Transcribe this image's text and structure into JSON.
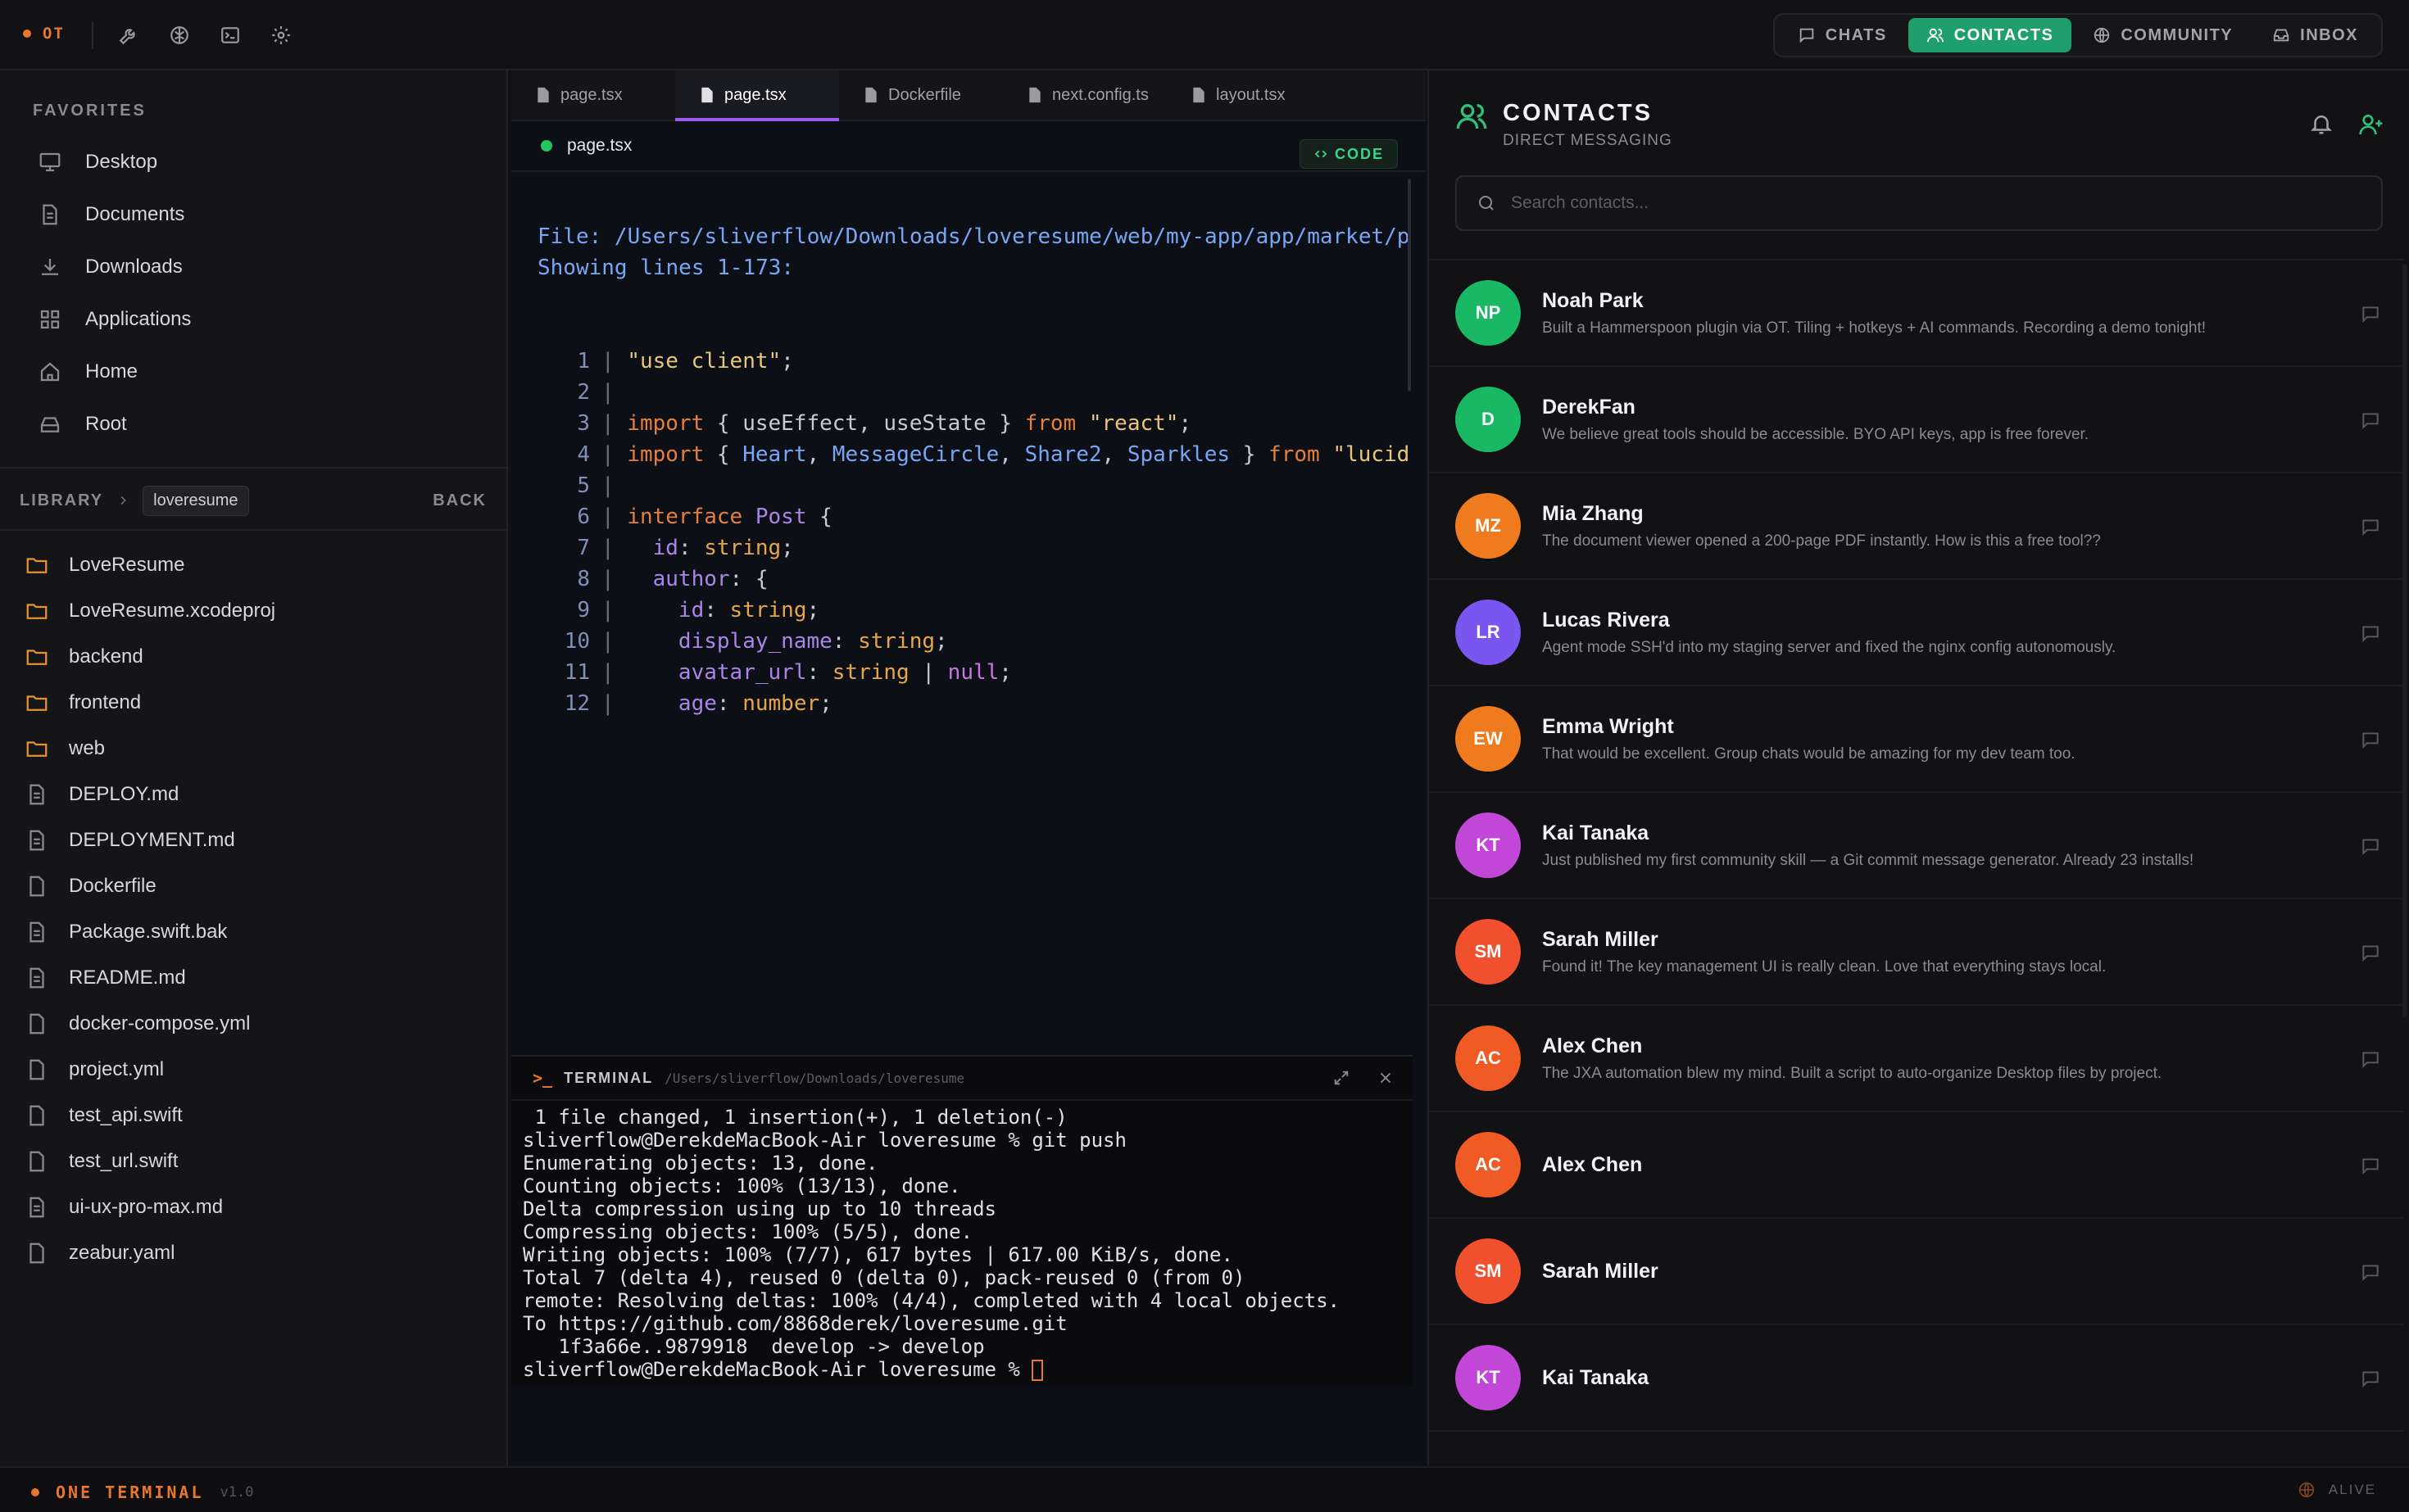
{
  "app": {
    "short_name": "OT",
    "name": "ONE TERMINAL",
    "version": "v1.0",
    "status": "ALIVE"
  },
  "topbar": {
    "icons": [
      "wrench-icon",
      "brain-icon",
      "terminal-icon",
      "gear-icon"
    ]
  },
  "nav": {
    "tabs": [
      {
        "label": "CHATS",
        "icon": "chat-icon",
        "active": false
      },
      {
        "label": "CONTACTS",
        "icon": "users-icon",
        "active": true
      },
      {
        "label": "COMMUNITY",
        "icon": "globe-icon",
        "active": false
      },
      {
        "label": "INBOX",
        "icon": "inbox-icon",
        "active": false
      }
    ]
  },
  "sidebar": {
    "favorites_title": "FAVORITES",
    "favorites": [
      {
        "label": "Desktop",
        "icon": "monitor-icon"
      },
      {
        "label": "Documents",
        "icon": "document-icon"
      },
      {
        "label": "Downloads",
        "icon": "download-icon"
      },
      {
        "label": "Applications",
        "icon": "grid-icon"
      },
      {
        "label": "Home",
        "icon": "home-icon"
      },
      {
        "label": "Root",
        "icon": "drive-icon"
      }
    ],
    "library_title": "LIBRARY",
    "breadcrumb": "loveresume",
    "back_label": "BACK",
    "files": [
      {
        "name": "LoveResume",
        "type": "folder"
      },
      {
        "name": "LoveResume.xcodeproj",
        "type": "folder"
      },
      {
        "name": "backend",
        "type": "folder"
      },
      {
        "name": "frontend",
        "type": "folder"
      },
      {
        "name": "web",
        "type": "folder"
      },
      {
        "name": "DEPLOY.md",
        "type": "doc"
      },
      {
        "name": "DEPLOYMENT.md",
        "type": "doc"
      },
      {
        "name": "Dockerfile",
        "type": "file"
      },
      {
        "name": "Package.swift.bak",
        "type": "doc"
      },
      {
        "name": "README.md",
        "type": "doc"
      },
      {
        "name": "docker-compose.yml",
        "type": "file"
      },
      {
        "name": "project.yml",
        "type": "file"
      },
      {
        "name": "test_api.swift",
        "type": "file"
      },
      {
        "name": "test_url.swift",
        "type": "file"
      },
      {
        "name": "ui-ux-pro-max.md",
        "type": "doc"
      },
      {
        "name": "zeabur.yaml",
        "type": "file"
      }
    ]
  },
  "editor": {
    "tabs": [
      {
        "label": "page.tsx",
        "active": false
      },
      {
        "label": "page.tsx",
        "active": true
      },
      {
        "label": "Dockerfile",
        "active": false
      },
      {
        "label": "next.config.ts",
        "active": false
      },
      {
        "label": "layout.tsx",
        "active": false
      }
    ],
    "current_file": "page.tsx",
    "code_button": "CODE",
    "file_line": "File: /Users/sliverflow/Downloads/loveresume/web/my-app/app/market/p",
    "showing_line": "Showing lines 1-173:"
  },
  "terminal": {
    "title": "TERMINAL",
    "path": "/Users/sliverflow/Downloads/loveresume",
    "lines": [
      " 1 file changed, 1 insertion(+), 1 deletion(-)",
      "sliverflow@DerekdeMacBook-Air loveresume % git push",
      "Enumerating objects: 13, done.",
      "Counting objects: 100% (13/13), done.",
      "Delta compression using up to 10 threads",
      "Compressing objects: 100% (5/5), done.",
      "Writing objects: 100% (7/7), 617 bytes | 617.00 KiB/s, done.",
      "Total 7 (delta 4), reused 0 (delta 0), pack-reused 0 (from 0)",
      "remote: Resolving deltas: 100% (4/4), completed with 4 local objects.",
      "To https://github.com/8868derek/loveresume.git",
      "   1f3a66e..9879918  develop -> develop"
    ],
    "prompt": "sliverflow@DerekdeMacBook-Air loveresume % "
  },
  "contacts_panel": {
    "title": "CONTACTS",
    "subtitle": "DIRECT MESSAGING",
    "search_placeholder": "Search contacts...",
    "contacts": [
      {
        "initials": "NP",
        "name": "Noah Park",
        "message": "Built a Hammerspoon plugin via OT. Tiling + hotkeys + AI commands. Recording a demo tonight!",
        "color": "#19b865"
      },
      {
        "initials": "D",
        "name": "DerekFan",
        "message": "We believe great tools should be accessible. BYO API keys, app is free forever.",
        "color": "#19b865"
      },
      {
        "initials": "MZ",
        "name": "Mia Zhang",
        "message": "The document viewer opened a 200-page PDF instantly. How is this a free tool??",
        "color": "#f07a1e"
      },
      {
        "initials": "LR",
        "name": "Lucas Rivera",
        "message": "Agent mode SSH'd into my staging server and fixed the nginx config autonomously.",
        "color": "#7b55f0"
      },
      {
        "initials": "EW",
        "name": "Emma Wright",
        "message": "That would be excellent. Group chats would be amazing for my dev team too.",
        "color": "#f07a1e"
      },
      {
        "initials": "KT",
        "name": "Kai Tanaka",
        "message": "Just published my first community skill — a Git commit message generator. Already 23 installs!",
        "color": "#c246d8"
      },
      {
        "initials": "SM",
        "name": "Sarah Miller",
        "message": "Found it! The key management UI is really clean. Love that everything stays local.",
        "color": "#f0502e"
      },
      {
        "initials": "AC",
        "name": "Alex Chen",
        "message": "The JXA automation blew my mind. Built a script to auto-organize Desktop files by project.",
        "color": "#f05a24"
      },
      {
        "initials": "AC",
        "name": "Alex Chen",
        "message": "",
        "color": "#f05a24"
      },
      {
        "initials": "SM",
        "name": "Sarah Miller",
        "message": "",
        "color": "#f0502e"
      },
      {
        "initials": "KT",
        "name": "Kai Tanaka",
        "message": "",
        "color": "#c246d8"
      }
    ]
  }
}
